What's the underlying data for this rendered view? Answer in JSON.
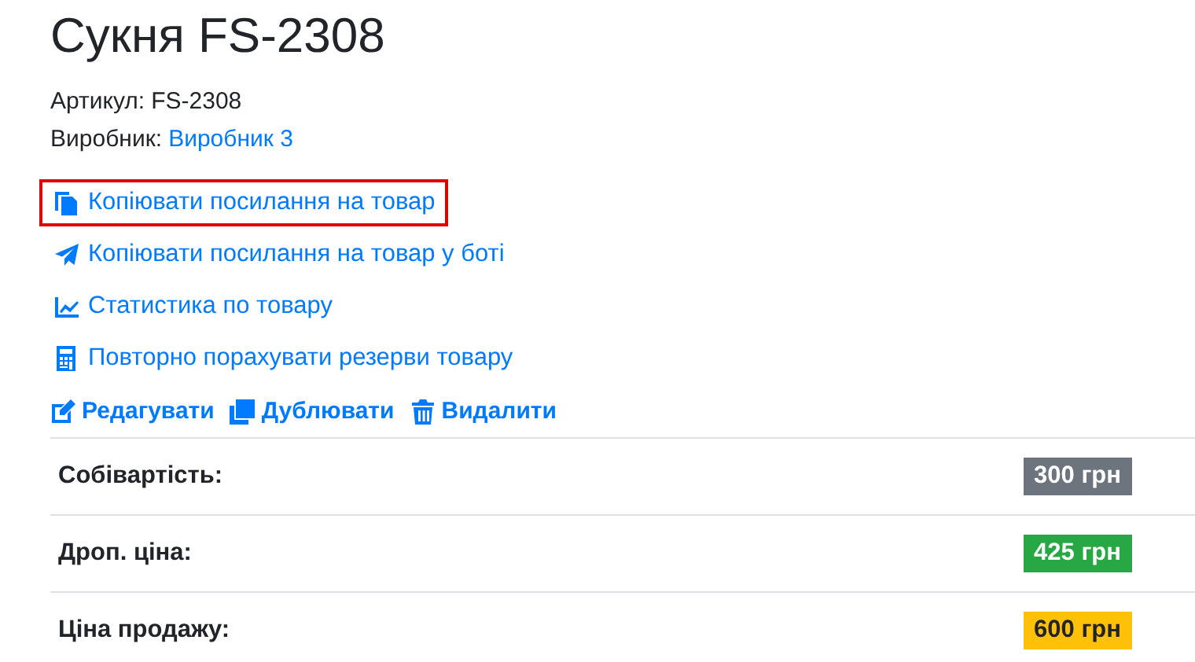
{
  "title": "Сукня FS-2308",
  "meta": [
    {
      "label": "Артикул:",
      "value": "FS-2308",
      "kind": "text"
    },
    {
      "label": "Виробник:",
      "value": "Виробник 3",
      "kind": "link"
    }
  ],
  "links": [
    {
      "label": "Копіювати посилання на товар",
      "kind": "copy",
      "highlighted": true
    },
    {
      "label": "Копіювати посилання на товар у боті",
      "kind": "send",
      "highlighted": false
    },
    {
      "label": "Статистика по товару",
      "kind": "chart",
      "highlighted": false
    },
    {
      "label": "Повторно порахувати резерви товару",
      "kind": "calculator",
      "highlighted": false
    }
  ],
  "actions": [
    {
      "label": "Редагувати",
      "kind": "edit"
    },
    {
      "label": "Дублювати",
      "kind": "duplicate"
    },
    {
      "label": "Видалити",
      "kind": "delete"
    }
  ],
  "prices": [
    {
      "label": "Собівартість:",
      "value": "300 грн",
      "color": "#6c757d"
    },
    {
      "label": "Дроп. ціна:",
      "value": "425 грн",
      "color": "#28a745"
    },
    {
      "label": "Ціна продажу:",
      "value": "600 грн",
      "color": "#ffc107"
    }
  ]
}
